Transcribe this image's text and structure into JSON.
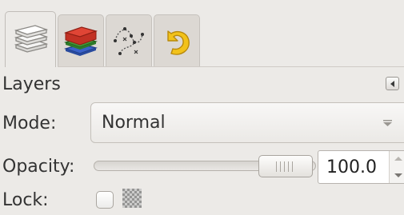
{
  "dock": {
    "tabs": [
      {
        "icon": "layers-icon",
        "active": true
      },
      {
        "icon": "channels-icon",
        "active": false
      },
      {
        "icon": "paths-icon",
        "active": false
      },
      {
        "icon": "undo-history-icon",
        "active": false
      }
    ],
    "title": "Layers",
    "collapse_icon": "triangle-left-icon"
  },
  "mode": {
    "label": "Mode:",
    "value": "Normal"
  },
  "opacity": {
    "label": "Opacity:",
    "value": "100.0",
    "level": 1.0
  },
  "lock": {
    "label": "Lock:",
    "alpha_icon": "lock-alpha-checker-icon",
    "checked": false
  },
  "colors": {
    "background": "#eceae7",
    "channels_red": "#d23a2c",
    "channels_green": "#3f9a3a",
    "channels_blue": "#3a62c9",
    "undo_yellow": "#f2c21a"
  }
}
